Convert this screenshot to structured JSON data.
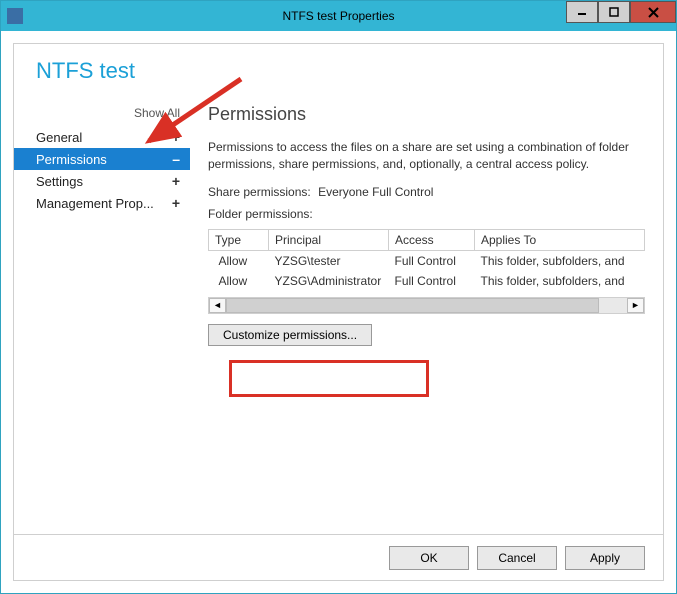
{
  "window": {
    "title": "NTFS test Properties"
  },
  "header": "NTFS test",
  "sidebar": {
    "show_all": "Show All",
    "items": [
      {
        "label": "General",
        "sign": "+"
      },
      {
        "label": "Permissions",
        "sign": "–"
      },
      {
        "label": "Settings",
        "sign": "+"
      },
      {
        "label": "Management Prop...",
        "sign": "+"
      }
    ]
  },
  "main": {
    "title": "Permissions",
    "desc": "Permissions to access the files on a share are set using a combination of folder permissions, share permissions, and, optionally, a central access policy.",
    "share_label": "Share permissions:",
    "share_value": "Everyone Full Control",
    "folder_label": "Folder permissions:",
    "columns": [
      "Type",
      "Principal",
      "Access",
      "Applies To"
    ],
    "rows": [
      {
        "type": "Allow",
        "principal": "YZSG\\tester",
        "access": "Full Control",
        "applies": "This folder, subfolders, and"
      },
      {
        "type": "Allow",
        "principal": "YZSG\\Administrator",
        "access": "Full Control",
        "applies": "This folder, subfolders, and"
      }
    ],
    "customize": "Customize permissions..."
  },
  "footer": {
    "ok": "OK",
    "cancel": "Cancel",
    "apply": "Apply"
  }
}
